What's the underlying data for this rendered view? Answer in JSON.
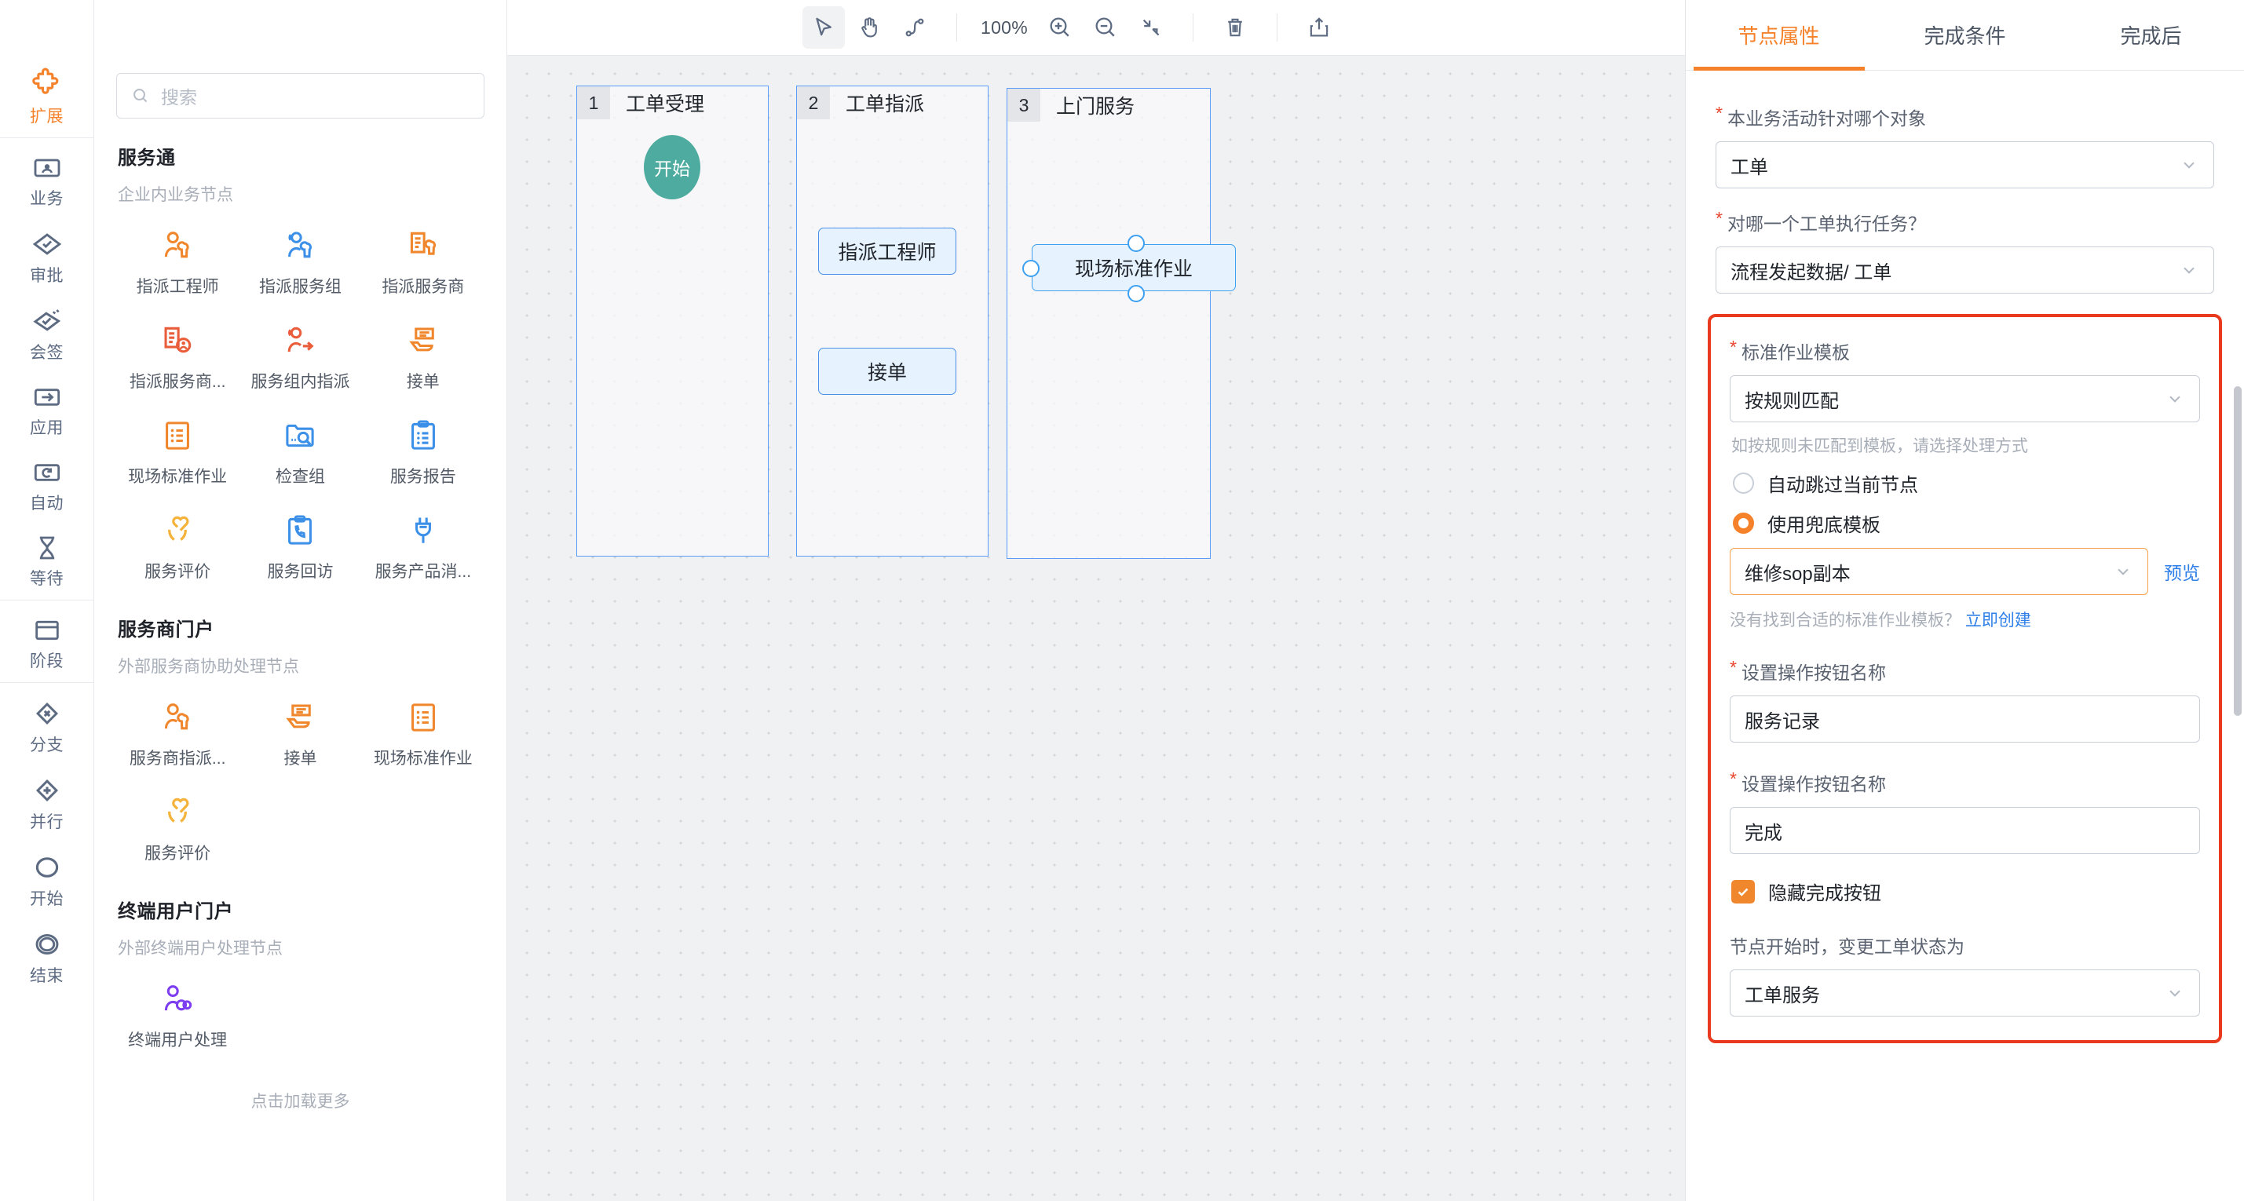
{
  "rail": {
    "items": [
      {
        "label": "扩展",
        "icon": "puzzle-icon",
        "active": true
      },
      {
        "label": "业务",
        "icon": "card-person-icon",
        "active": false
      },
      {
        "label": "审批",
        "icon": "diamond-check-icon",
        "active": false
      },
      {
        "label": "会签",
        "icon": "diamond-double-check-icon",
        "active": false
      },
      {
        "label": "应用",
        "icon": "arrow-right-box-icon",
        "active": false
      },
      {
        "label": "自动",
        "icon": "refresh-box-icon",
        "active": false
      },
      {
        "label": "等待",
        "icon": "hourglass-icon",
        "active": false
      },
      {
        "label": "阶段",
        "icon": "window-icon",
        "active": false
      },
      {
        "label": "分支",
        "icon": "diamond-x-icon",
        "active": false
      },
      {
        "label": "并行",
        "icon": "diamond-plus-icon",
        "active": false
      },
      {
        "label": "开始",
        "icon": "circle-icon",
        "active": false
      },
      {
        "label": "结束",
        "icon": "double-circle-icon",
        "active": false
      }
    ]
  },
  "library": {
    "search_placeholder": "搜索",
    "load_more": "点击加载更多",
    "groups": [
      {
        "title": "服务通",
        "subtitle": "企业内业务节点",
        "nodes": [
          {
            "label": "指派工程师",
            "icon": "person-wrench-icon",
            "color": "#f0872d"
          },
          {
            "label": "指派服务组",
            "icon": "group-wrench-icon",
            "color": "#3d90e8"
          },
          {
            "label": "指派服务商",
            "icon": "doc-plug-icon",
            "color": "#f0872d"
          },
          {
            "label": "指派服务商...",
            "icon": "doc-person-icon",
            "color": "#ea5d3a"
          },
          {
            "label": "服务组内指派",
            "icon": "person-arrow-icon",
            "color": "#ea5d3a"
          },
          {
            "label": "接单",
            "icon": "hand-doc-icon",
            "color": "#f0872d"
          },
          {
            "label": "现场标准作业",
            "icon": "checklist-icon",
            "color": "#f0872d"
          },
          {
            "label": "检查组",
            "icon": "folder-search-icon",
            "color": "#3d90e8"
          },
          {
            "label": "服务报告",
            "icon": "clipboard-list-icon",
            "color": "#3d90e8"
          },
          {
            "label": "服务评价",
            "icon": "heart-hand-icon",
            "color": "#f5b33c"
          },
          {
            "label": "服务回访",
            "icon": "clipboard-phone-icon",
            "color": "#3d90e8"
          },
          {
            "label": "服务产品消...",
            "icon": "plug-icon",
            "color": "#3d90e8"
          }
        ]
      },
      {
        "title": "服务商门户",
        "subtitle": "外部服务商协助处理节点",
        "nodes": [
          {
            "label": "服务商指派...",
            "icon": "person-wrench-icon",
            "color": "#f0872d"
          },
          {
            "label": "接单",
            "icon": "hand-doc-icon",
            "color": "#f0872d"
          },
          {
            "label": "现场标准作业",
            "icon": "checklist-icon",
            "color": "#f0872d"
          },
          {
            "label": "服务评价",
            "icon": "heart-hand-icon",
            "color": "#f5b33c"
          }
        ]
      },
      {
        "title": "终端用户门户",
        "subtitle": "外部终端用户处理节点",
        "nodes": [
          {
            "label": "终端用户处理",
            "icon": "person-link-icon",
            "color": "#7d3df0"
          }
        ]
      }
    ]
  },
  "toolbar": {
    "zoom_level": "100%",
    "buttons": [
      {
        "name": "select-tool",
        "icon": "cursor-icon",
        "selected": true
      },
      {
        "name": "pan-tool",
        "icon": "hand-icon",
        "selected": false
      },
      {
        "name": "connector-tool",
        "icon": "curve-link-icon",
        "selected": false
      },
      {
        "name": "zoom-in",
        "icon": "zoom-in-icon",
        "selected": false
      },
      {
        "name": "zoom-out",
        "icon": "zoom-out-icon",
        "selected": false
      },
      {
        "name": "fit-view",
        "icon": "fit-screen-icon",
        "selected": false
      },
      {
        "name": "delete",
        "icon": "trash-icon",
        "selected": false
      },
      {
        "name": "export",
        "icon": "upload-icon",
        "selected": false
      }
    ]
  },
  "canvas": {
    "lanes": [
      {
        "num": "1",
        "name": "工单受理"
      },
      {
        "num": "2",
        "name": "工单指派"
      },
      {
        "num": "3",
        "name": "上门服务"
      }
    ],
    "nodes": [
      {
        "label": "开始",
        "type": "start"
      },
      {
        "label": "指派工程师",
        "type": "task"
      },
      {
        "label": "接单",
        "type": "task"
      },
      {
        "label": "现场标准作业",
        "type": "task",
        "selected": true
      }
    ]
  },
  "props": {
    "tabs": [
      {
        "label": "节点属性",
        "active": true
      },
      {
        "label": "完成条件",
        "active": false
      },
      {
        "label": "完成后",
        "active": false
      }
    ],
    "fields": {
      "object_label": "本业务活动针对哪个对象",
      "object_value": "工单",
      "target_label": "对哪一个工单执行任务？",
      "target_value": "流程发起数据/ 工单",
      "sop_label": "标准作业模板",
      "sop_value": "按规则匹配",
      "sop_hint": "如按规则未匹配到模板，请选择处理方式",
      "radio_skip": "自动跳过当前节点",
      "radio_fallback": "使用兜底模板",
      "fallback_value": "维修sop副本",
      "preview_link": "预览",
      "create_note": "没有找到合适的标准作业模板？",
      "create_link": "立即创建",
      "btn1_label": "设置操作按钮名称",
      "btn1_value": "服务记录",
      "btn2_label": "设置操作按钮名称",
      "btn2_value": "完成",
      "hide_finish_label": "隐藏完成按钮",
      "status_label": "节点开始时，变更工单状态为",
      "status_value": "工单服务"
    }
  },
  "colors": {
    "accent_orange": "#f5822a",
    "highlight_red": "#ea3a1e",
    "node_blue": "#4a90ea",
    "start_green": "#4eab9f",
    "lane_blue": "#5b9cf8",
    "link_blue": "#2f7fe8"
  }
}
